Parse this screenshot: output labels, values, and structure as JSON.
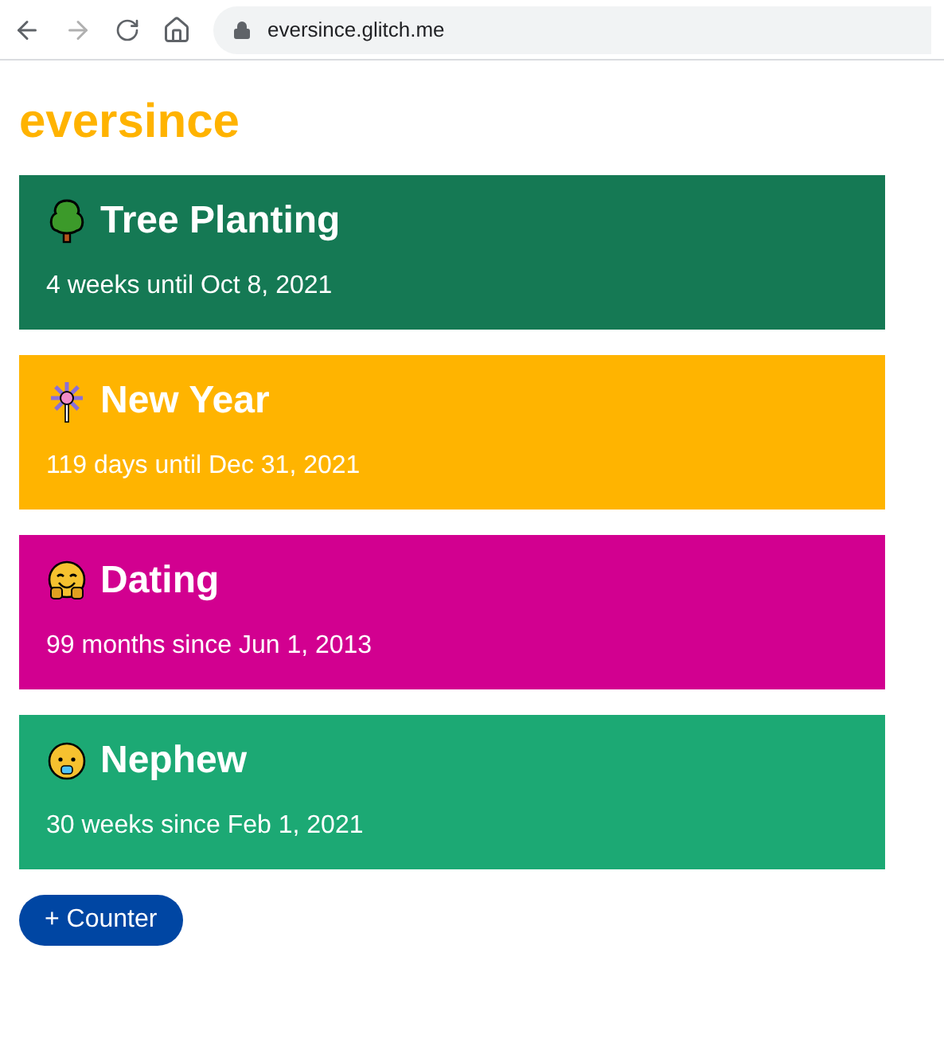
{
  "browser": {
    "url": "eversince.glitch.me"
  },
  "site_title": "eversince",
  "counters": [
    {
      "kind": "tree",
      "title": "Tree Planting",
      "subtitle": "4 weeks until Oct 8, 2021",
      "color": "#157954"
    },
    {
      "kind": "firework",
      "title": "New Year",
      "subtitle": "119 days until Dec 31, 2021",
      "color": "#ffb400"
    },
    {
      "kind": "hug",
      "title": "Dating",
      "subtitle": "99 months since Jun 1, 2013",
      "color": "#d20090"
    },
    {
      "kind": "baby",
      "title": "Nephew",
      "subtitle": "30 weeks since Feb 1, 2021",
      "color": "#1ca974"
    }
  ],
  "add_button": "+ Counter"
}
